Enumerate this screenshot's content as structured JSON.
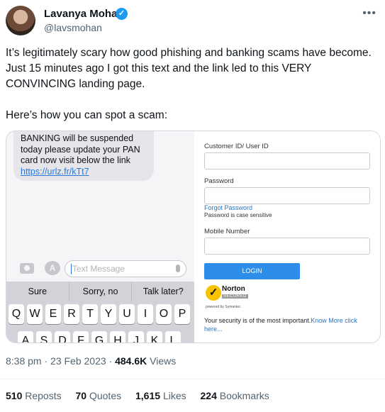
{
  "author": {
    "name": "Lavanya Mohan",
    "handle": "@lavsmohan",
    "verified_color": "#1d9bf0"
  },
  "tweet": {
    "paragraph1": "It’s legitimately scary how good phishing and banking scams have become. Just 15 minutes ago I got this text and the link led to this VERY CONVINCING landing page.",
    "paragraph2": "Here’s how you can spot a scam:"
  },
  "media": {
    "sms": {
      "line1": "BANKING will be suspended",
      "line2": "today please update your PAN",
      "line3": "card now visit below the link",
      "link": "https://urlz.fr/kTt7"
    },
    "compose_placeholder": "Text Message",
    "suggestions": [
      "Sure",
      "Sorry, no",
      "Talk later?"
    ],
    "keyboard_row1": [
      "Q",
      "W",
      "E",
      "R",
      "T",
      "Y",
      "U",
      "I",
      "O",
      "P"
    ],
    "keyboard_row2": [
      "A",
      "S",
      "D",
      "F",
      "G",
      "H",
      "J",
      "K",
      "L"
    ],
    "login": {
      "customer_label": "Customer ID/ User ID",
      "password_label": "Password",
      "forgot": "Forgot Password",
      "password_hint": "Password is case sensitive",
      "mobile_label": "Mobile Number",
      "button": "LOGIN",
      "norton_brand": "Norton",
      "norton_secured": "SECURED",
      "norton_powered": "powered by Symantec",
      "security_text": "Your security is of the most important.",
      "know_more": "Know More click here..."
    }
  },
  "meta": {
    "time": "8:38 pm · 23 Feb 2023 · ",
    "views_count": "484.6K",
    "views_label": " Views"
  },
  "stats": [
    {
      "count": "510",
      "label": "Reposts"
    },
    {
      "count": "70",
      "label": "Quotes"
    },
    {
      "count": "1,615",
      "label": "Likes"
    },
    {
      "count": "224",
      "label": "Bookmarks"
    }
  ]
}
